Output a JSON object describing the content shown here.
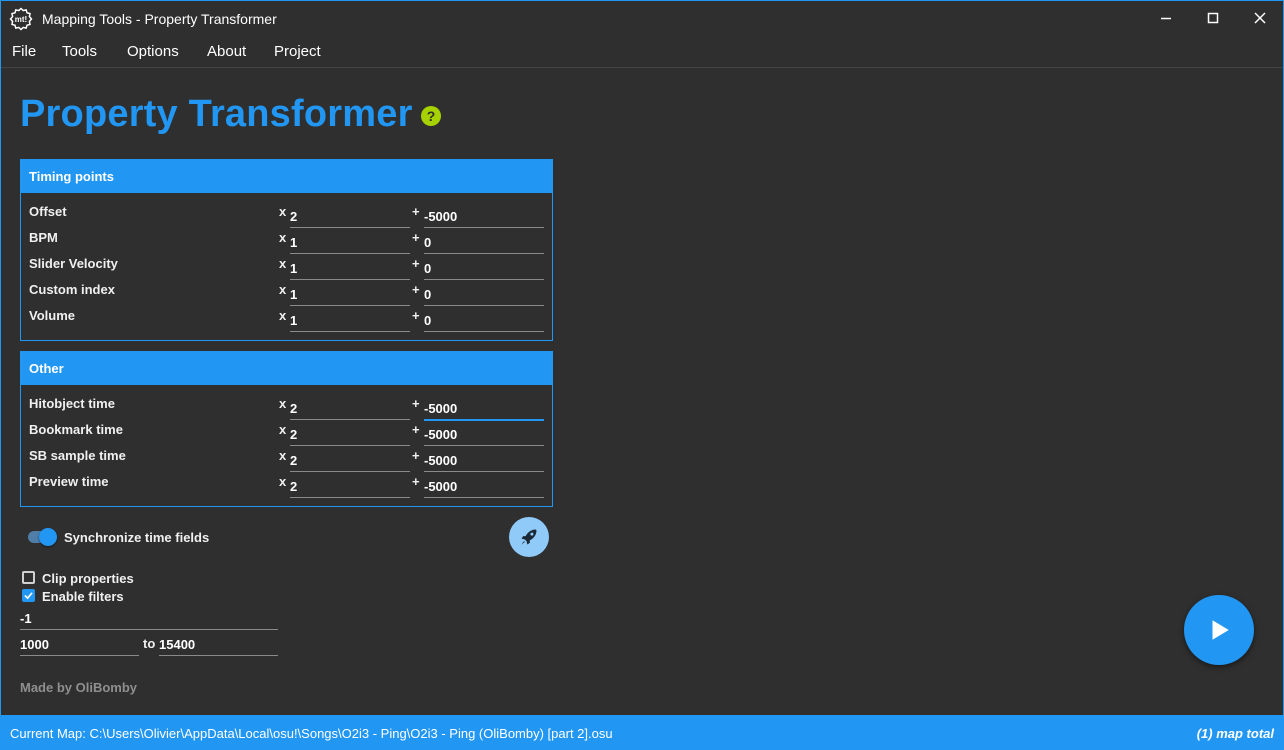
{
  "window": {
    "title": "Mapping Tools - Property Transformer",
    "logo_text": "mt!"
  },
  "menu": [
    "File",
    "Tools",
    "Options",
    "About",
    "Project"
  ],
  "page": {
    "title": "Property Transformer",
    "help_icon": "question-icon"
  },
  "timing_points": {
    "header": "Timing points",
    "rows": [
      {
        "label": "Offset",
        "multiplier": "2",
        "offset": "-5000"
      },
      {
        "label": "BPM",
        "multiplier": "1",
        "offset": "0"
      },
      {
        "label": "Slider Velocity",
        "multiplier": "1",
        "offset": "0"
      },
      {
        "label": "Custom index",
        "multiplier": "1",
        "offset": "0"
      },
      {
        "label": "Volume",
        "multiplier": "1",
        "offset": "0"
      }
    ]
  },
  "other": {
    "header": "Other",
    "rows": [
      {
        "label": "Hitobject time",
        "multiplier": "2",
        "offset": "-5000"
      },
      {
        "label": "Bookmark time",
        "multiplier": "2",
        "offset": "-5000"
      },
      {
        "label": "SB sample time",
        "multiplier": "2",
        "offset": "-5000"
      },
      {
        "label": "Preview time",
        "multiplier": "2",
        "offset": "-5000"
      }
    ]
  },
  "operators": {
    "multiply": "x",
    "add": "+"
  },
  "sync": {
    "label": "Synchronize time fields",
    "on": true
  },
  "clip": {
    "label": "Clip properties",
    "checked": false
  },
  "filters": {
    "label": "Enable filters",
    "checked": true,
    "value_filter": "-1",
    "time_from": "1000",
    "to_label": "to",
    "time_to": "15400"
  },
  "credit": "Made by OliBomby",
  "status": {
    "current_map": "Current Map: C:\\Users\\Olivier\\AppData\\Local\\osu!\\Songs\\O2i3 - Ping\\O2i3 - Ping (OliBomby) [part 2].osu",
    "map_count": "(1) map total"
  },
  "colors": {
    "accent": "#2196f3",
    "background": "#2f2f2f",
    "help": "#a6d200",
    "rocket_button": "#90caf9"
  }
}
